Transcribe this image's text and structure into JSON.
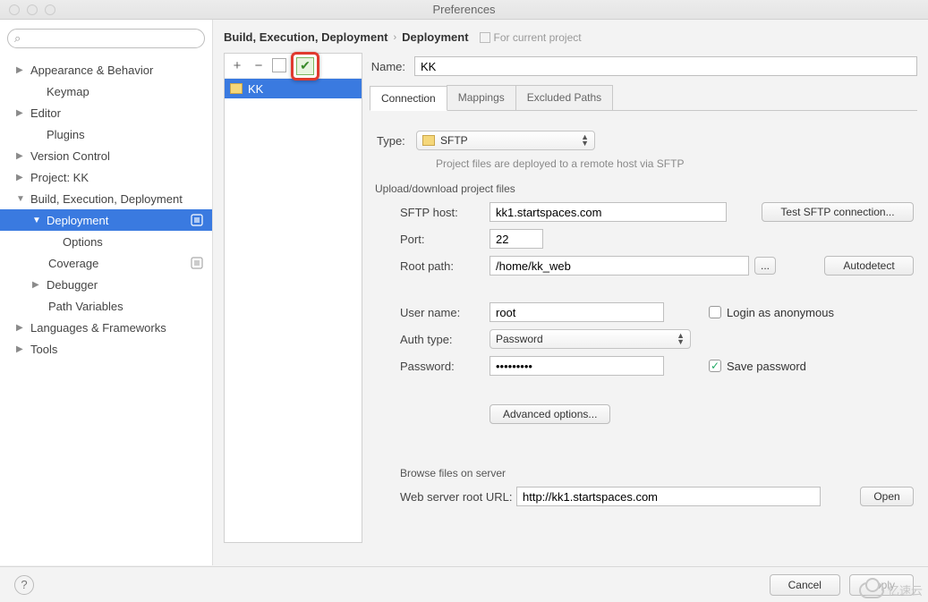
{
  "window": {
    "title": "Preferences"
  },
  "search": {
    "placeholder": ""
  },
  "sidebar": {
    "items": [
      {
        "label": "Appearance & Behavior",
        "expandable": true,
        "expanded": false,
        "level": 0
      },
      {
        "label": "Keymap",
        "expandable": false,
        "level": 1
      },
      {
        "label": "Editor",
        "expandable": true,
        "expanded": false,
        "level": 0
      },
      {
        "label": "Plugins",
        "expandable": false,
        "level": 1
      },
      {
        "label": "Version Control",
        "expandable": true,
        "expanded": false,
        "level": 0
      },
      {
        "label": "Project: KK",
        "expandable": true,
        "expanded": false,
        "level": 0
      },
      {
        "label": "Build, Execution, Deployment",
        "expandable": true,
        "expanded": true,
        "level": 0
      },
      {
        "label": "Deployment",
        "expandable": true,
        "expanded": true,
        "level": 1,
        "selected": true
      },
      {
        "label": "Options",
        "expandable": false,
        "level": 2
      },
      {
        "label": "Coverage",
        "expandable": false,
        "level": 1
      },
      {
        "label": "Debugger",
        "expandable": true,
        "expanded": false,
        "level": 1
      },
      {
        "label": "Path Variables",
        "expandable": false,
        "level": 1
      },
      {
        "label": "Languages & Frameworks",
        "expandable": true,
        "expanded": false,
        "level": 0
      },
      {
        "label": "Tools",
        "expandable": true,
        "expanded": false,
        "level": 0
      }
    ]
  },
  "breadcrumb": {
    "part1": "Build, Execution, Deployment",
    "part2": "Deployment",
    "hint": "For current project"
  },
  "servers": {
    "toolbar": {
      "add": "+",
      "remove": "−"
    },
    "items": [
      {
        "label": "KK"
      }
    ]
  },
  "form": {
    "name_label": "Name:",
    "name_value": "KK",
    "tabs": [
      {
        "label": "Connection",
        "active": true
      },
      {
        "label": "Mappings",
        "active": false
      },
      {
        "label": "Excluded Paths",
        "active": false
      }
    ],
    "type_label": "Type:",
    "type_value": "SFTP",
    "type_hint": "Project files are deployed to a remote host via SFTP",
    "upload_section": "Upload/download project files",
    "sftp_host_label": "SFTP host:",
    "sftp_host_value": "kk1.startspaces.com",
    "test_btn": "Test SFTP connection...",
    "port_label": "Port:",
    "port_value": "22",
    "root_label": "Root path:",
    "root_value": "/home/kk_web",
    "dots": "...",
    "autodetect_btn": "Autodetect",
    "user_label": "User name:",
    "user_value": "root",
    "anon_label": "Login as anonymous",
    "auth_label": "Auth type:",
    "auth_value": "Password",
    "pass_label": "Password:",
    "pass_value": "•••••••••",
    "save_pass_label": "Save password",
    "advanced_btn": "Advanced options...",
    "browse_section": "Browse files on server",
    "web_url_label": "Web server root URL:",
    "web_url_value": "http://kk1.startspaces.com",
    "open_btn": "Open"
  },
  "footer": {
    "help": "?",
    "cancel": "Cancel",
    "apply": "Apply"
  },
  "watermark": "亿速云"
}
